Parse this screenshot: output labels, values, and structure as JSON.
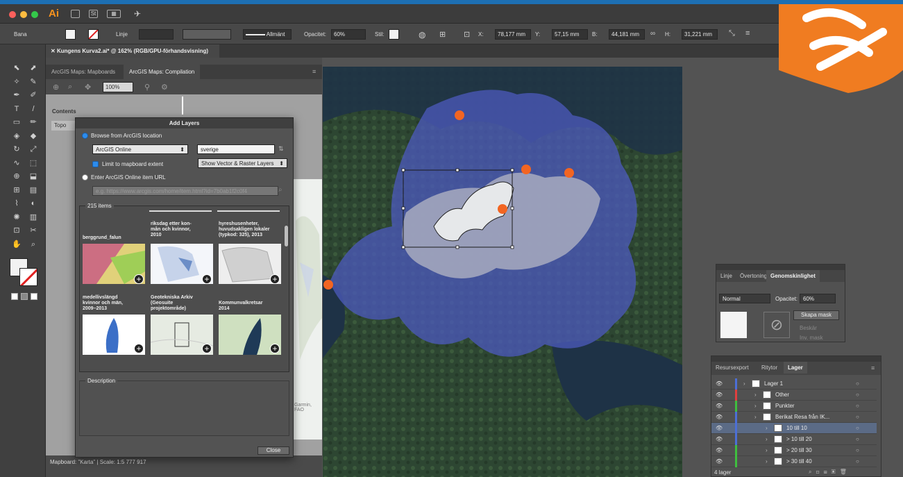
{
  "app": {
    "name": "Ai"
  },
  "controlbar": {
    "item_type": "Bana",
    "stroke_label": "Linje",
    "style_profile": "Allmänt",
    "opacity_label": "Opacitet:",
    "opacity_value": "60%",
    "style_label": "Stil:",
    "x_label": "X:",
    "x_value": "78,177 mm",
    "y_label": "Y:",
    "y_value": "57,15 mm",
    "w_label": "B:",
    "w_value": "44,181 mm",
    "h_label": "H:",
    "h_value": "31,221 mm"
  },
  "document": {
    "tab_title": "Kungens Kurva2.ai* @ 162% (RGB/GPU-förhandsvisning)"
  },
  "arcgis": {
    "tabs": [
      "ArcGIS Maps: Mapboards",
      "ArcGIS Maps: Compilation"
    ],
    "zoom": "100%",
    "contents_label": "Contents",
    "top_label": "Topo",
    "status": "Mapboard: \"Karta\" | Scale: 1:5 777 917",
    "map_attribution": "Garmin, FAO"
  },
  "add_layers": {
    "title": "Add Layers",
    "browse_label": "Browse from ArcGIS location",
    "source": "ArcGIS Online",
    "search_value": "sverige",
    "limit_label": "Limit to mapboard extent",
    "filter": "Show Vector & Raster Layers",
    "url_label": "Enter ArcGIS Online item URL",
    "url_placeholder": "e.g. https://www.arcgis.com/home/item.html?id=7b0ab1f2c0f4",
    "items_count": "215 items",
    "items": [
      {
        "title": "berggrund_falun"
      },
      {
        "title": "riksdag etter kon-\nmån och kvinnor,\n2010"
      },
      {
        "title": "hyreshusenheter,\nhuvudsakligen lokaler\n(typkod: 325), 2013"
      },
      {
        "title": "medellivslängd\nkvinnor och män,\n2009–2013"
      },
      {
        "title": "Geotekniska Arkiv\n(Geosuite\nprojektområde)"
      },
      {
        "title": "Kommunvalkretsar\n2014"
      }
    ],
    "description_label": "Description",
    "close_label": "Close"
  },
  "transparency_panel": {
    "tabs": [
      "Linje",
      "Övertoning",
      "Genomskinlighet"
    ],
    "blend_mode": "Normal",
    "opacity_label": "Opacitet:",
    "opacity_value": "60%",
    "mask_button": "Skapa mask",
    "clip_label": "Beskär",
    "invert_label": "Inv. mask"
  },
  "layers_panel": {
    "tabs": [
      "Resursexport",
      "Ritytor",
      "Lager"
    ],
    "rows": [
      {
        "name": "Lager 1",
        "color": "#4c6fd6",
        "indent": 0
      },
      {
        "name": "Other",
        "color": "#e04040",
        "indent": 1
      },
      {
        "name": "Punkter",
        "color": "#3fbf3f",
        "indent": 1
      },
      {
        "name": "Berikat Resa från IK...",
        "color": "#4c6fd6",
        "indent": 1
      },
      {
        "name": "10 till 10",
        "color": "#4c6fd6",
        "indent": 2
      },
      {
        "name": "> 10 till 20",
        "color": "#4c6fd6",
        "indent": 2
      },
      {
        "name": "> 20 till 30",
        "color": "#3fbf3f",
        "indent": 2
      },
      {
        "name": "> 30 till 40",
        "color": "#3fbf3f",
        "indent": 2
      }
    ],
    "footer": "4 lager"
  }
}
